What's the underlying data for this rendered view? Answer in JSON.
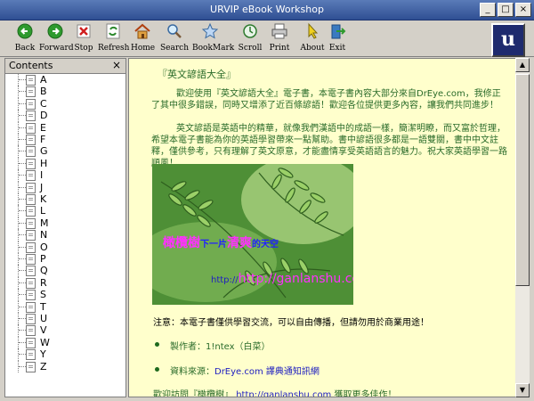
{
  "window": {
    "title": "URVIP eBook Workshop",
    "buttons": [
      "_",
      "□",
      "×"
    ]
  },
  "toolbar": {
    "buttons": [
      {
        "label": "Back",
        "icon": "back-arrow-icon"
      },
      {
        "label": "Forward",
        "icon": "forward-arrow-icon"
      },
      {
        "label": "Stop",
        "icon": "stop-icon"
      },
      {
        "label": "Refresh",
        "icon": "refresh-icon"
      },
      {
        "label": "Home",
        "icon": "home-icon"
      },
      {
        "label": "Search",
        "icon": "search-icon"
      },
      {
        "label": "BookMark",
        "icon": "bookmark-star-icon"
      },
      {
        "label": "Scroll",
        "icon": "scroll-icon"
      },
      {
        "label": "Print",
        "icon": "printer-icon"
      },
      {
        "label": "About",
        "icon": "pointer-icon"
      },
      {
        "label": "Exit",
        "icon": "exit-icon"
      }
    ]
  },
  "sidebar": {
    "title": "Contents",
    "close": "×",
    "items": [
      "A",
      "B",
      "C",
      "D",
      "E",
      "F",
      "G",
      "H",
      "I",
      "J",
      "K",
      "L",
      "M",
      "N",
      "O",
      "P",
      "Q",
      "R",
      "S",
      "T",
      "U",
      "V",
      "W",
      "Y",
      "Z"
    ]
  },
  "content": {
    "title": "『英文諺語大全』",
    "para1": "歡迎使用『英文諺語大全』電子書，本電子書內容大部分來自DrEye.com，我修正了其中很多錯誤，同時又增添了近百條諺語！歡迎各位提供更多內容，讓我們共同進步！",
    "para2": "英文諺語是英語中的精華，就像我們漢語中的成語一樣，簡潔明瞭，而又富於哲理，希望本電子書能為你的英語學習帶來一點幫助。書中諺語很多都是一語雙關，書中中文註釋，僅供參考，只有理解了英文原意，才能盡情享受英語語言的魅力。祝大家英語學習一路順風！",
    "banner": {
      "tagline_a": "橄欖樹",
      "tagline_b": "下一片",
      "tagline_c": "清爽",
      "tagline_d": "的天空",
      "url": "http://ganlanshu.com"
    },
    "notice": "注意：本電子書僅供學習交流，可以自由傳播，但請勿用於商業用途！",
    "bullets": [
      {
        "label": "製作者：",
        "value": "1!ntex（白菜）"
      },
      {
        "label": "資料來源：",
        "value": "DrEye.com 譯典通知訊網"
      }
    ],
    "footer_a": "歡迎訪問『橄欖樹』",
    "footer_url": "http://ganlanshu.com",
    "footer_b": " 獲取更多佳作！"
  },
  "colors": {
    "content_bg": "#ffffcc",
    "text_green": "#2a6b2a",
    "link_blue": "#2020c0",
    "titlebar": "#3f5fa3"
  }
}
